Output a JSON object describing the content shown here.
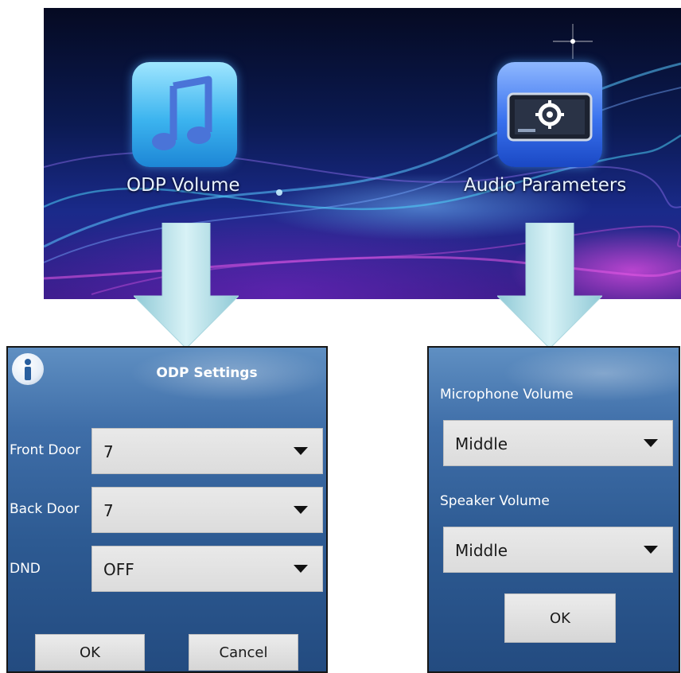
{
  "banner": {
    "apps": [
      {
        "label": "ODP Volume",
        "icon": "music-note-icon"
      },
      {
        "label": "Audio Parameters",
        "icon": "settings-screen-icon"
      }
    ]
  },
  "odp_dialog": {
    "title": "ODP Settings",
    "icon": "info-icon",
    "rows": [
      {
        "label": "Front Door",
        "value": "7"
      },
      {
        "label": "Back Door",
        "value": "7"
      },
      {
        "label": "DND",
        "value": "OFF"
      }
    ],
    "ok_label": "OK",
    "cancel_label": "Cancel"
  },
  "audio_dialog": {
    "rows": [
      {
        "label": "Microphone Volume",
        "value": "Middle"
      },
      {
        "label": "Speaker Volume",
        "value": "Middle"
      }
    ],
    "ok_label": "OK"
  },
  "colors": {
    "dialog_blue": "#2d5a92",
    "arrow_cyan": "#bfe6ee",
    "select_gray": "#dcdcdc"
  }
}
